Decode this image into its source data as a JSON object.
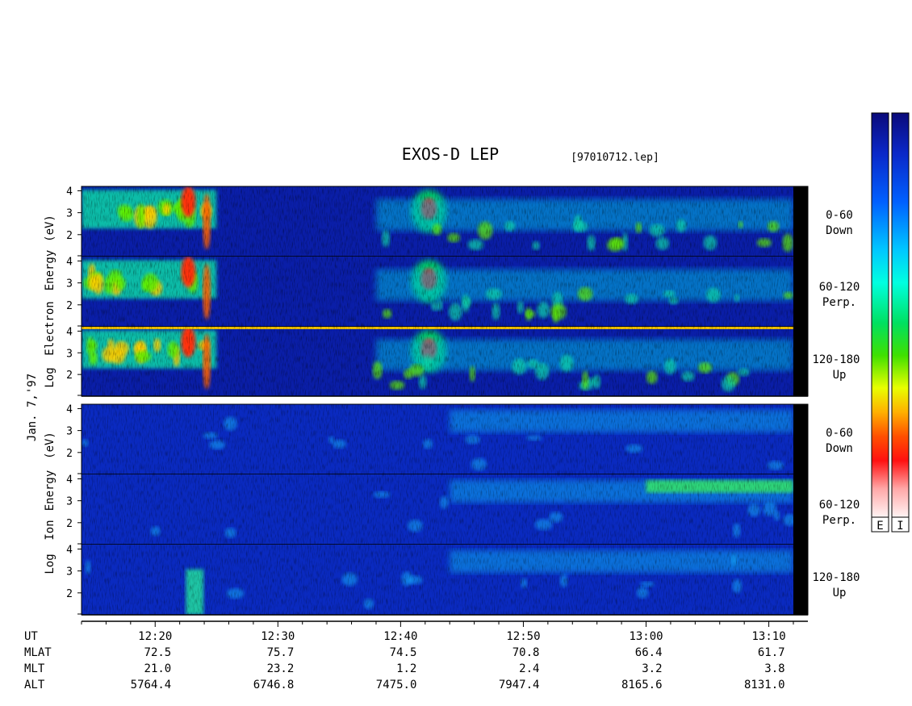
{
  "title": "EXOS-D LEP",
  "file_label": "[97010712.lep]",
  "date_label": "Jan. 7,'97",
  "electron_ylabel": [
    "Log",
    "Electron",
    "Energy",
    "(eV)"
  ],
  "ion_ylabel": [
    "Log",
    "Ion",
    "Energy",
    "(eV)"
  ],
  "pitch_labels": [
    {
      "range": "0-60",
      "dir": "Down"
    },
    {
      "range": "60-120",
      "dir": "Perp."
    },
    {
      "range": "120-180",
      "dir": "Up"
    }
  ],
  "colorbar_labels": [
    "E",
    "I"
  ],
  "row_labels": [
    "UT",
    "MLAT",
    "MLT",
    "ALT"
  ],
  "columns": [
    {
      "UT": "12:20",
      "MLAT": "72.5",
      "MLT": "21.0",
      "ALT": "5764.4"
    },
    {
      "UT": "12:30",
      "MLAT": "75.7",
      "MLT": "23.2",
      "ALT": "6746.8"
    },
    {
      "UT": "12:40",
      "MLAT": "74.5",
      "MLT": "1.2",
      "ALT": "7475.0"
    },
    {
      "UT": "12:50",
      "MLAT": "70.8",
      "MLT": "2.4",
      "ALT": "7947.4"
    },
    {
      "UT": "13:00",
      "MLAT": "66.4",
      "MLT": "3.2",
      "ALT": "8165.6"
    },
    {
      "UT": "13:10",
      "MLAT": "61.7",
      "MLT": "3.8",
      "ALT": "8131.0"
    }
  ],
  "chart_data": {
    "type": "heatmap",
    "title": "EXOS-D LEP",
    "x_axis": {
      "label": "UT",
      "range": [
        "12:14",
        "13:12"
      ],
      "major_ticks": [
        "12:20",
        "12:30",
        "12:40",
        "12:50",
        "13:00",
        "13:10"
      ],
      "minor_tick_minutes": 2
    },
    "y_axis": {
      "label": "Log Energy (eV)",
      "ticks": [
        2,
        3,
        4
      ],
      "range": [
        1,
        4.2
      ],
      "scale": "log10"
    },
    "colormap": [
      "#f8f0f0",
      "#ff1010",
      "#ff9a00",
      "#ffff00",
      "#00e000",
      "#00ffff",
      "#0050ff",
      "#0a0a90"
    ],
    "panels": [
      {
        "species": "Electron",
        "pitch": "0-60 Down"
      },
      {
        "species": "Electron",
        "pitch": "60-120 Perp."
      },
      {
        "species": "Electron",
        "pitch": "120-180 Up"
      },
      {
        "species": "Ion",
        "pitch": "0-60 Down"
      },
      {
        "species": "Ion",
        "pitch": "60-120 Perp."
      },
      {
        "species": "Ion",
        "pitch": "120-180 Up"
      }
    ]
  }
}
